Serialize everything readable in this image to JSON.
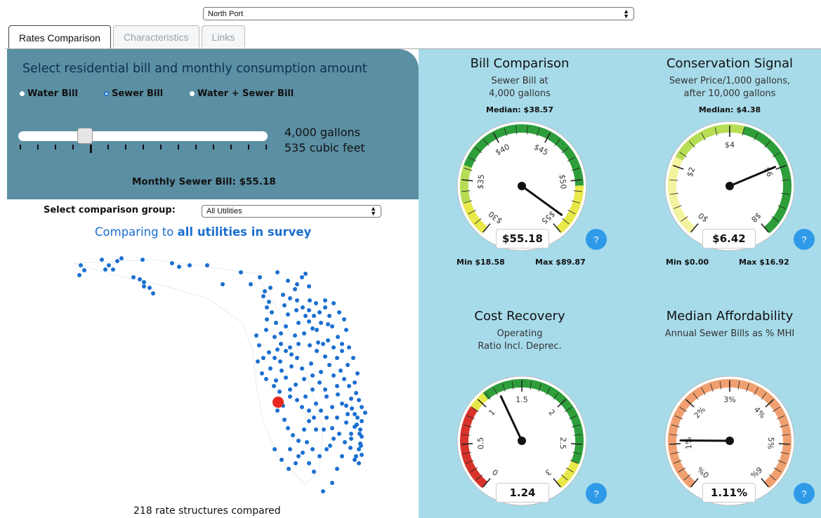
{
  "header": {
    "utility_select": "North Port",
    "tabs": [
      {
        "label": "Rates Comparison",
        "active": true
      },
      {
        "label": "Characteristics",
        "active": false
      },
      {
        "label": "Links",
        "active": false
      }
    ]
  },
  "bill_panel": {
    "title": "Select residential bill and monthly consumption amount",
    "radios": [
      {
        "label": "Water Bill",
        "selected": false
      },
      {
        "label": "Sewer Bill",
        "selected": true
      },
      {
        "label": "Water + Sewer Bill",
        "selected": false
      }
    ],
    "gallons": "4,000 gallons",
    "cubic_feet": "535 cubic feet",
    "monthly_bill": "Monthly Sewer Bill: $55.18"
  },
  "comparison": {
    "group_label": "Select comparison group:",
    "group_value": "All Utilities",
    "comparing_prefix": "Comparing to ",
    "comparing_bold": "all utilities in survey",
    "structures": "218 rate structures compared"
  },
  "gauges": {
    "bill": {
      "title": "Bill Comparison",
      "sub1": "Sewer Bill at",
      "sub2": "4,000 gallons",
      "median": "Median: $38.57",
      "value": "$55.18",
      "min": "Min $18.58",
      "max": "Max $89.87",
      "labels": [
        "$30",
        "$35",
        "$40",
        "$45",
        "$50",
        "$55"
      ]
    },
    "conservation": {
      "title": "Conservation Signal",
      "sub1": "Sewer Price/1,000 gallons,",
      "sub2": "after 10,000 gallons",
      "median": "Median: $4.38",
      "value": "$6.42",
      "min": "Min $0.00",
      "max": "Max $16.92",
      "labels": [
        "$0",
        "$2",
        "$4",
        "$6",
        "$8"
      ]
    },
    "cost": {
      "title": "Cost Recovery",
      "sub1": "Operating",
      "sub2": "Ratio Incl. Deprec.",
      "value": "1.24",
      "labels": [
        "0",
        "0.5",
        "1",
        "1.5",
        "2",
        "2.5",
        "3"
      ]
    },
    "afford": {
      "title": "Median Affordability",
      "sub1": "Annual Sewer Bills as % MHI",
      "value": "1.11%",
      "labels": [
        "0%",
        "1%",
        "2%",
        "3%",
        "4%",
        "5%",
        "6%"
      ]
    },
    "help": "?"
  },
  "colors": {
    "panel_bg": "#a7dbea",
    "bill_box": "#5b8fa3",
    "dot": "#1a6fd0",
    "highlight_dot": "#e8281e",
    "green": "#2e9e3a",
    "yellow": "#e8e84a",
    "red": "#d8332a",
    "orange": "#f0a070"
  }
}
